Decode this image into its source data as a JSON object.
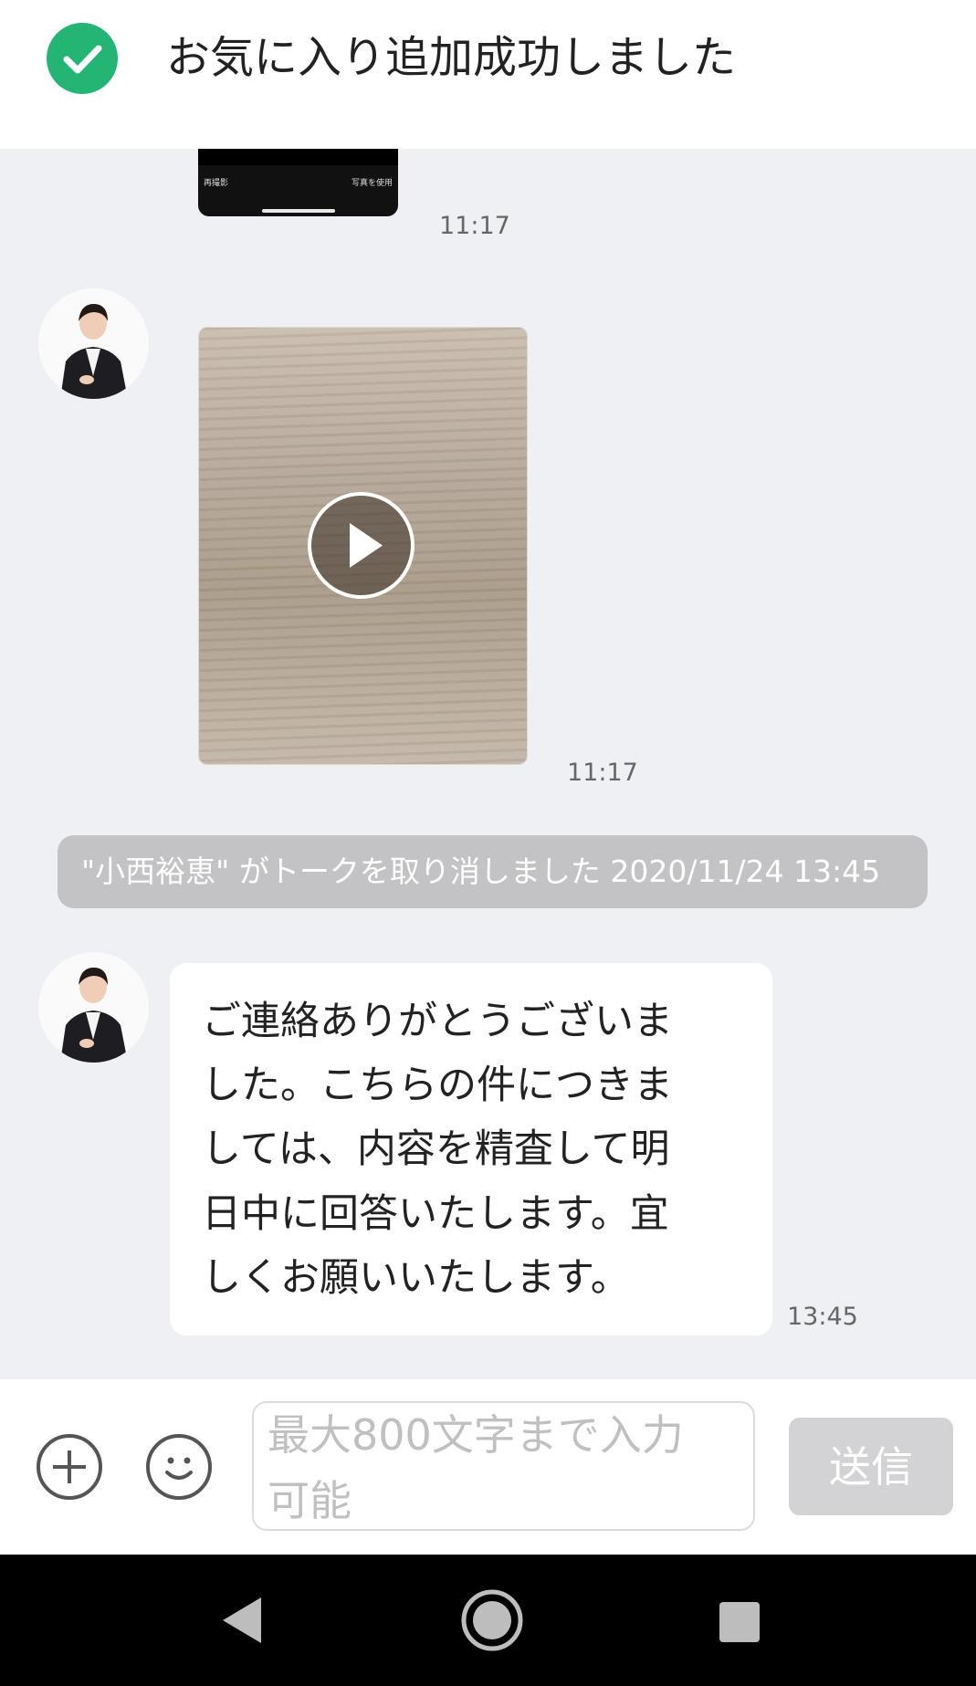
{
  "toast": {
    "text": "お気に入り追加成功しました"
  },
  "photo_thumb": {
    "left_label": "再撮影",
    "right_label": "写真を使用"
  },
  "messages": {
    "image_time": "11:17",
    "video_time": "11:17",
    "text_time": "13:45",
    "text_lines": [
      "ご連絡ありがとうございま",
      "した。こちらの件につきま",
      "しては、内容を精査して明",
      "日中に回答いたします。宜",
      "しくお願いいたします。"
    ]
  },
  "system_notice": "\"小西裕恵\" がトークを取り消しました 2020/11/24 13:45",
  "input": {
    "placeholder_lines": [
      "最大800文字まで入力",
      "可能"
    ],
    "send_label": "送信"
  },
  "colors": {
    "accent_green": "#22b573",
    "background": "#eff0f4",
    "notice_bg": "#c3c3c5"
  },
  "icons": [
    "check-icon",
    "play-icon",
    "add-icon",
    "emoji-icon",
    "back-icon",
    "home-icon",
    "recents-icon"
  ]
}
